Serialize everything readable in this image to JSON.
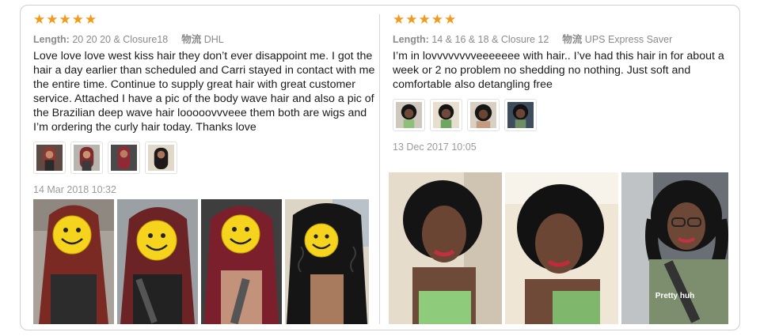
{
  "reviews": [
    {
      "stars": [
        "★",
        "★",
        "★",
        "★",
        "★"
      ],
      "length_label": "Length:",
      "length_value": "20 20 20 & Closure18",
      "shipping_label": "物流",
      "shipping_value": "DHL",
      "text": "Love love love west kiss hair they don’t ever disappoint me. I got the hair a day earlier than scheduled and Carri stayed in contact with me the entire time. Continue to supply great hair with great customer service. Attached I have a pic of the body wave hair and also a pic of the Brazilian deep wave hair looooovvveee them both are wigs and I’m ordering the curly hair today. Thanks love",
      "date": "14 Mar 2018 10:32"
    },
    {
      "stars": [
        "★",
        "★",
        "★",
        "★",
        "★"
      ],
      "length_label": "Length:",
      "length_value": "14 & 16 & 18 & Closure 12",
      "shipping_label": "物流",
      "shipping_value": "UPS Express Saver",
      "text": "I’m in lovvvvvvvveeeeeee with hair.. I’ve had this hair in for about a week or 2 no problem no shedding no nothing. Just soft and comfortable also detangling free",
      "date": "13 Dec 2017 10:05",
      "photo_caption": "Pretty huh"
    }
  ],
  "colors": {
    "star": "#f39a1a",
    "meta": "#8a8a8a",
    "border": "#cfcfcf"
  }
}
